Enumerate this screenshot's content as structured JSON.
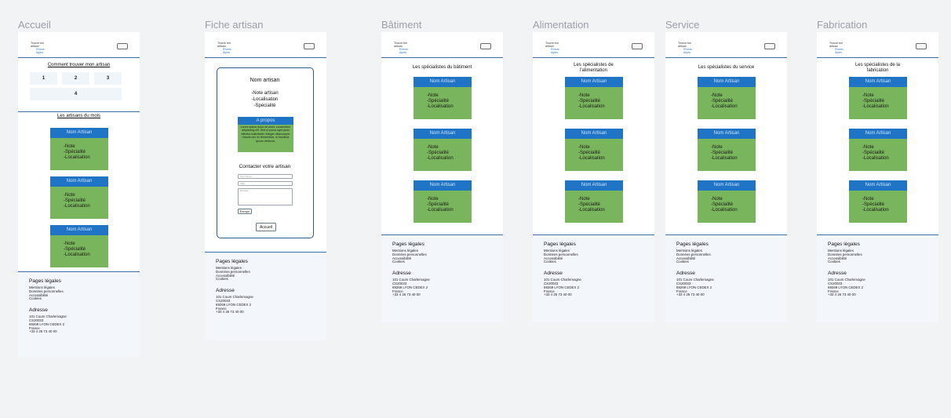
{
  "frames": [
    {
      "id": "accueil",
      "title": "Accueil"
    },
    {
      "id": "fiche",
      "title": "Fiche artisan"
    },
    {
      "id": "batiment",
      "title": "Bâtiment",
      "section": "Les spécialistes du bâtiment"
    },
    {
      "id": "alimentation",
      "title": "Alimentation",
      "section_line1": "Les spécialistes de",
      "section_line2": "l'alimentation"
    },
    {
      "id": "service",
      "title": "Service",
      "section": "Les spécialistes du service"
    },
    {
      "id": "fabrication",
      "title": "Fabrication",
      "section_line1": "Les spécialistes de la",
      "section_line2": "fabrication"
    }
  ],
  "header": {
    "logo_line1": "Trouve ton artisan",
    "logo_line2": "Rhône-Alpes"
  },
  "accueil": {
    "how_title": "Comment trouver mon artisan",
    "steps": [
      "1",
      "2",
      "3",
      "4"
    ],
    "month_title": "Les artisans du mois"
  },
  "card": {
    "name": "Nom Artisan",
    "note": "-Note",
    "specialite": "-Spécialité",
    "localisation": "-Localisation"
  },
  "fiche": {
    "name": "Nom artisan",
    "note": "-Note artisan",
    "localisation": "-Localisation",
    "specialite": "-Spécialité",
    "apropos_title": "A propos",
    "apropos_text": "Lorem ipsum dolor sit amet, consectetur adipiscing elit. Sed ut purus eget justo efficitur sollicitudin. Integer ullamcorper mauris nec ex fermentum, in faucibus ipsum vehicula.",
    "contact_title": "Contacter votre artisan",
    "field_name": "Nom Prénom",
    "field_subject": "Objet",
    "field_message": "Message",
    "send_label": "Envoyer",
    "home_label": "Accueil"
  },
  "footer": {
    "legal_title": "Pages légales",
    "legal_items": [
      "Mentions légales",
      "Données personnelles",
      "Accessibilité",
      "Cookies"
    ],
    "address_title": "Adresse",
    "address_lines": [
      "101 Cours Charlemagne",
      "CS20033",
      "69269 LYON CEDEX 2",
      "France",
      "+33 4 26 73 40 00"
    ]
  }
}
